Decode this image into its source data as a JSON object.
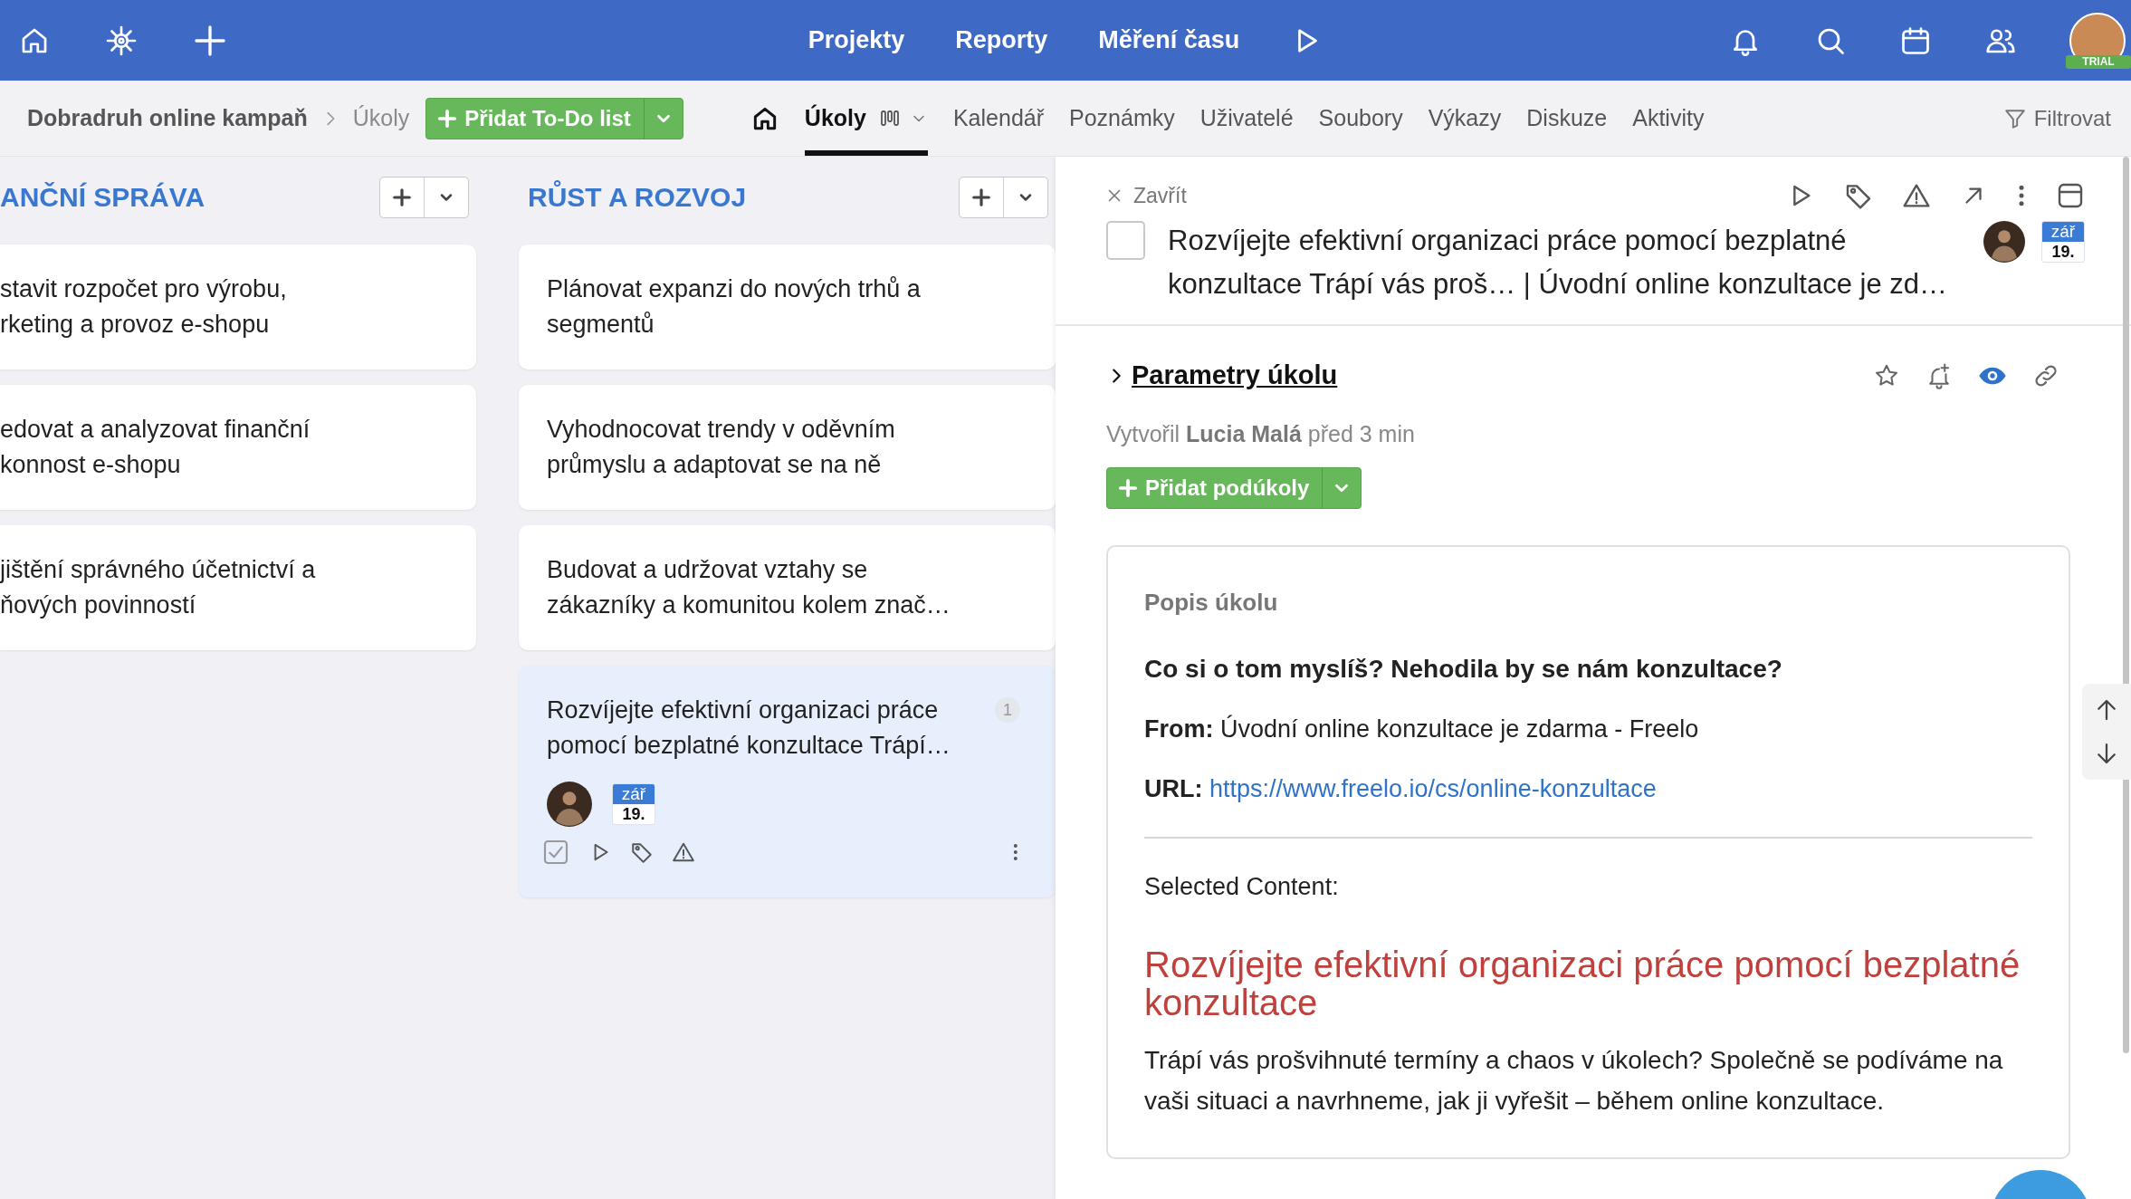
{
  "top_bar": {
    "nav": [
      {
        "label": "Projekty"
      },
      {
        "label": "Reporty"
      },
      {
        "label": "Měření času"
      }
    ],
    "account_badge": "TRIAL"
  },
  "breadcrumb": {
    "project": "Dobradruh online kampaň",
    "current": "Úkoly"
  },
  "add_todo_button": "Přidat To-Do list",
  "tabs": [
    {
      "label": "Úkoly",
      "selected": true
    },
    {
      "label": "Kalendář",
      "selected": false
    },
    {
      "label": "Poznámky",
      "selected": false
    },
    {
      "label": "Uživatelé",
      "selected": false
    },
    {
      "label": "Soubory",
      "selected": false
    },
    {
      "label": "Výkazy",
      "selected": false
    },
    {
      "label": "Diskuze",
      "selected": false
    },
    {
      "label": "Aktivity",
      "selected": false
    }
  ],
  "filter_button": "Filtrovat",
  "columns": [
    {
      "title": "ANČNÍ SPRÁVA",
      "cards": [
        {
          "text": "stavit rozpočet pro výrobu,\nrketing a provoz e-shopu",
          "selected": false
        },
        {
          "text": "edovat a analyzovat finanční\nkonnost e-shopu",
          "selected": false
        },
        {
          "text": "jištění správného účetnictví a\nňových povinností",
          "selected": false
        }
      ]
    },
    {
      "title": "RŮST A ROZVOJ",
      "cards": [
        {
          "text": "Plánovat expanzi do nových trhů a\nsegmentů",
          "selected": false
        },
        {
          "text": "Vyhodnocovat trendy v oděvním\nprůmyslu a adaptovat se na ně",
          "selected": false
        },
        {
          "text": "Budovat a udržovat vztahy se\nzákazníky a komunitou kolem znač…",
          "selected": false
        },
        {
          "text": "Rozvíjejte efektivní organizaci práce\npomocí bezplatné konzultace Trápí…",
          "selected": true,
          "count": "1",
          "due": {
            "month": "zář",
            "day": "19."
          }
        }
      ]
    }
  ],
  "detail": {
    "close": "Zavřít",
    "checked": false,
    "title": "Rozvíjejte efektivní organizaci práce pomocí bezplatné\nkonzultace Trápí vás proš… | Úvodní online konzultace je zd…",
    "due": {
      "month": "zář",
      "day": "19."
    },
    "params_title": "Parametry úkolu",
    "created": "Vytvořil **Lucia Malá** před 3 min",
    "add_subtasks_button": "Přidat podúkoly",
    "description": {
      "heading": "Popis úkolu",
      "question": "Co si o tom myslíš? Nehodila by se nám konzultace?",
      "from": "**From:** Úvodní online konzultace je zdarma - Freelo",
      "url_label": "URL:",
      "url": "https://www.freelo.io/cs/online-konzultace",
      "selected_label": "Selected Content:",
      "article_title": "Rozvíjejte efektivní organizaci práce pomocí bezplatné konzultace",
      "article_text": "Trápí vás prošvihnuté termíny a chaos v úkolech? Společně se podíváme na vaši situaci a navrhneme, jak ji vyřešit – během online konzultace."
    }
  }
}
